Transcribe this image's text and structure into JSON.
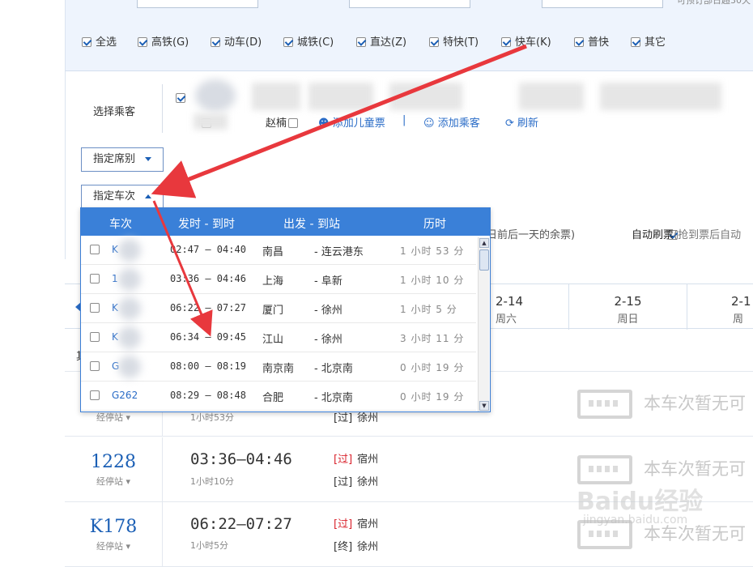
{
  "filters": {
    "top_right_text": "可预订部日超30天",
    "types": [
      {
        "label": "全选",
        "checked": true
      },
      {
        "label": "高铁(G)",
        "checked": true
      },
      {
        "label": "动车(D)",
        "checked": true
      },
      {
        "label": "城铁(C)",
        "checked": true
      },
      {
        "label": "直达(Z)",
        "checked": true
      },
      {
        "label": "特快(T)",
        "checked": true
      },
      {
        "label": "快车(K)",
        "checked": true
      },
      {
        "label": "普快",
        "checked": true
      },
      {
        "label": "其它",
        "checked": true
      }
    ]
  },
  "passengers": {
    "label": "选择乘客",
    "zhao_nan": "赵楠",
    "add_child": "添加儿童票",
    "separator": "|",
    "add_passenger": "添加乘客",
    "refresh": "刷新"
  },
  "seat_select": {
    "label": "指定席别"
  },
  "train_select": {
    "label": "指定车次"
  },
  "options": {
    "nearby_tail": "日前后一天的余票)",
    "auto_refresh_label": "自动刷票",
    "auto_refresh_note": "(抢到票后自动"
  },
  "dropdown": {
    "headers": {
      "code": "车次",
      "times": "发时 - 到时",
      "route": "出发 - 到站",
      "duration": "历时"
    },
    "rows": [
      {
        "code": "K",
        "time": "02:47 — 04:40",
        "from": "南昌",
        "to": "- 连云港东",
        "dur": "1 小时 53 分"
      },
      {
        "code": "1",
        "time": "03:36 — 04:46",
        "from": "上海",
        "to": "- 阜新",
        "dur": "1 小时 10 分"
      },
      {
        "code": "K",
        "time": "06:22 — 07:27",
        "from": "厦门",
        "to": "- 徐州",
        "dur": "1 小时 5 分"
      },
      {
        "code": "K",
        "time": "06:34 — 09:45",
        "from": "江山",
        "to": "- 徐州",
        "dur": "3 小时 11 分"
      },
      {
        "code": "G",
        "time": "08:00 — 08:19",
        "from": "南京南",
        "to": "- 北京南",
        "dur": "0 小时 19 分"
      },
      {
        "code": "G262",
        "time": "08:29 — 08:48",
        "from": "合肥",
        "to": "- 北京南",
        "dur": "0 小时 19 分"
      }
    ],
    "scroll_up": "▲",
    "scroll_down": "▼"
  },
  "datebar": [
    {
      "date": "2-14",
      "weekday": "周六"
    },
    {
      "date": "2-15",
      "weekday": "周日"
    },
    {
      "date": "2-1",
      "weekday": "周一"
    }
  ],
  "results": {
    "partial_label": "其",
    "rows": [
      {
        "code": "",
        "stops": "经停站",
        "time": "",
        "duration": "1小时53分",
        "line1_tag": "",
        "line1": "",
        "line2_tag": "[过]",
        "line2": "徐州",
        "status": "本车次暂无可"
      },
      {
        "code": "1228",
        "stops": "经停站",
        "time": "03:36—04:46",
        "duration": "1小时10分",
        "line1_tag": "[过]",
        "line1": "宿州",
        "line2_tag": "[过]",
        "line2": "徐州",
        "status": "本车次暂无可"
      },
      {
        "code": "K178",
        "stops": "经停站",
        "time": "06:22—07:27",
        "duration": "1小时5分",
        "line1_tag": "[过]",
        "line1": "宿州",
        "line2_tag": "[终]",
        "line2": "徐州",
        "status": "本车次暂无可"
      }
    ]
  },
  "watermark": {
    "text": "Baidu经验",
    "url": "jingyan.baidu.com"
  },
  "colors": {
    "accent": "#3a80d8",
    "link": "#2a6cc7",
    "train_code": "#1b5fb5",
    "arrow": "#e8383d"
  }
}
